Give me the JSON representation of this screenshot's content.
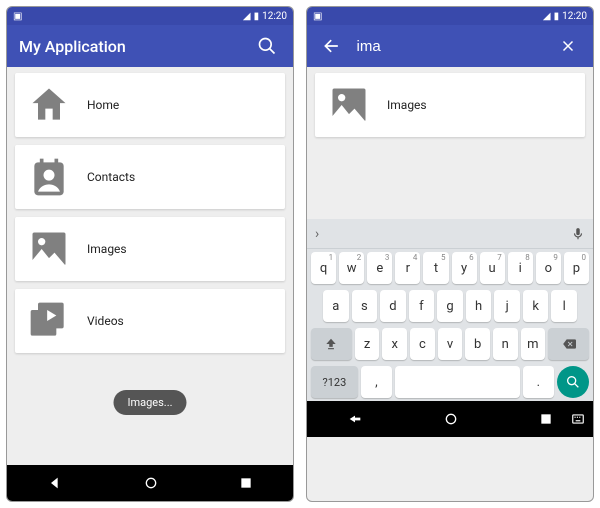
{
  "status": {
    "time": "12:20"
  },
  "left": {
    "title": "My Application",
    "items": [
      {
        "label": "Home"
      },
      {
        "label": "Contacts"
      },
      {
        "label": "Images"
      },
      {
        "label": "Videos"
      }
    ],
    "toast": "Images..."
  },
  "right": {
    "search_value": "ima",
    "results": [
      {
        "label": "Images"
      }
    ]
  },
  "keyboard": {
    "row1": [
      "q",
      "w",
      "e",
      "r",
      "t",
      "y",
      "u",
      "i",
      "o",
      "p"
    ],
    "nums": [
      "1",
      "2",
      "3",
      "4",
      "5",
      "6",
      "7",
      "8",
      "9",
      "0"
    ],
    "row2": [
      "a",
      "s",
      "d",
      "f",
      "g",
      "h",
      "j",
      "k",
      "l"
    ],
    "row3": [
      "z",
      "x",
      "c",
      "v",
      "b",
      "n",
      "m"
    ],
    "sym": "?123",
    "comma": ",",
    "period": "."
  }
}
